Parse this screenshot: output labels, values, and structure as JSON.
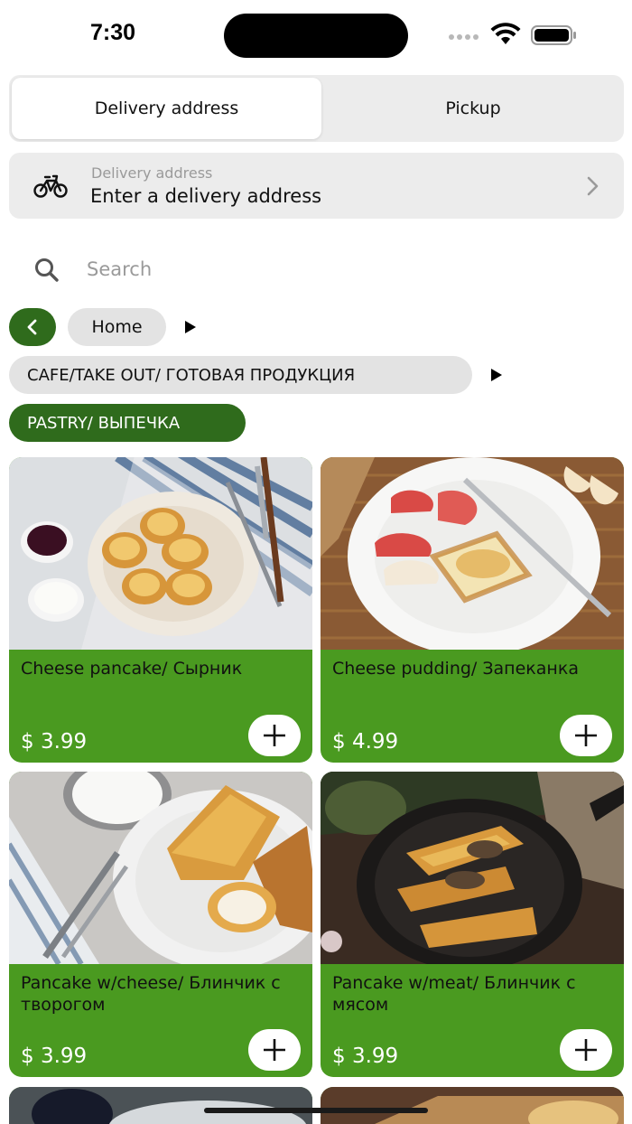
{
  "status_bar": {
    "time": "7:30"
  },
  "segmented": {
    "options": [
      {
        "label": "Delivery address",
        "selected": true
      },
      {
        "label": "Pickup",
        "selected": false
      }
    ]
  },
  "delivery": {
    "caption": "Delivery address",
    "value": "Enter a delivery address",
    "icon": "bicycle-icon"
  },
  "search": {
    "placeholder": "Search",
    "value": ""
  },
  "breadcrumbs": {
    "home": "Home",
    "category": "CAFE/TAKE OUT/ ГОТОВАЯ ПРОДУКЦИЯ",
    "subcategory": "PASTRY/ ВЫПЕЧКА"
  },
  "products": [
    {
      "name": "Cheese pancake/ Сырник",
      "price": "$ 3.99",
      "image": "syrniki-photo"
    },
    {
      "name": "Cheese pudding/ Запеканка",
      "price": "$ 4.99",
      "image": "casserole-photo"
    },
    {
      "name": "Pancake w/cheese/ Блинчик с творогом",
      "price": "$ 3.99",
      "image": "cheese-crepes-photo"
    },
    {
      "name": "Pancake w/meat/ Блинчик с мясом",
      "price": "$ 3.99",
      "image": "meat-crepes-photo"
    }
  ],
  "colors": {
    "accent_dark_green": "#2f6b1c",
    "card_green": "#4a9a20",
    "chip_gray": "#e3e3e3",
    "panel_gray": "#ececec"
  }
}
